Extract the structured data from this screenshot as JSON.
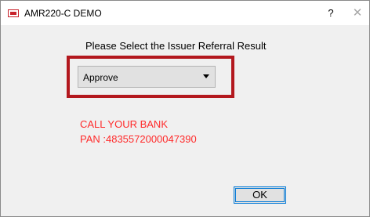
{
  "window": {
    "title": "AMR220-C DEMO",
    "help_glyph": "?",
    "close_glyph": "✕"
  },
  "dialog": {
    "prompt": "Please Select the Issuer Referral Result",
    "select": {
      "value": "Approve"
    },
    "message_line1": "CALL YOUR BANK",
    "message_line2": "PAN :4835572000047390",
    "ok_label": "OK"
  },
  "colors": {
    "message_red": "#ff2a2a",
    "highlight_red": "#b3181e",
    "focus_blue": "#0078d7"
  }
}
